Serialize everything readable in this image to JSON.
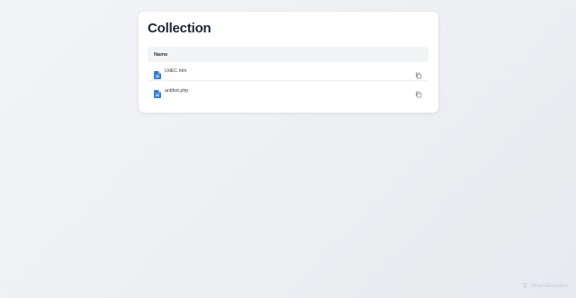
{
  "page": {
    "title": "Collection"
  },
  "table": {
    "header": "Name",
    "rows": [
      {
        "name": "UdEC.htm",
        "icon": "file-document-icon"
      },
      {
        "name": "antibot.php",
        "icon": "file-document-icon"
      }
    ]
  },
  "brand": {
    "name": "ScanMalware",
    "color": "#c9d5e8"
  },
  "colors": {
    "accent": "#2f7fd8",
    "card": "#ffffff"
  }
}
